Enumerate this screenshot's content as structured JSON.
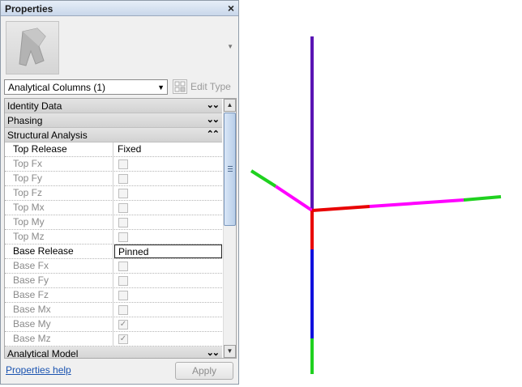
{
  "panel": {
    "title": "Properties",
    "close_glyph": "×"
  },
  "type_selector": {
    "value": "Analytical Columns (1)",
    "edit_type_label": "Edit Type"
  },
  "groups": {
    "identity": {
      "label": "Identity Data",
      "state": "collapsed"
    },
    "phasing": {
      "label": "Phasing",
      "state": "collapsed"
    },
    "structural": {
      "label": "Structural Analysis",
      "state": "expanded"
    },
    "analytical_model": {
      "label": "Analytical Model",
      "state": "collapsed"
    }
  },
  "params": {
    "top_release": {
      "name": "Top Release",
      "value": "Fixed"
    },
    "top_fx": {
      "name": "Top Fx",
      "checked": false
    },
    "top_fy": {
      "name": "Top Fy",
      "checked": false
    },
    "top_fz": {
      "name": "Top Fz",
      "checked": false
    },
    "top_mx": {
      "name": "Top Mx",
      "checked": false
    },
    "top_my": {
      "name": "Top My",
      "checked": false
    },
    "top_mz": {
      "name": "Top Mz",
      "checked": false
    },
    "base_release": {
      "name": "Base Release",
      "value": "Pinned"
    },
    "base_fx": {
      "name": "Base Fx",
      "checked": false
    },
    "base_fy": {
      "name": "Base Fy",
      "checked": false
    },
    "base_fz": {
      "name": "Base Fz",
      "checked": false
    },
    "base_mx": {
      "name": "Base Mx",
      "checked": false
    },
    "base_my": {
      "name": "Base My",
      "checked": true
    },
    "base_mz": {
      "name": "Base Mz",
      "checked": true
    }
  },
  "footer": {
    "help_link": "Properties help",
    "apply_label": "Apply"
  },
  "colors": {
    "axis_x": "#ff00ff",
    "axis_y": "#2f2fd2",
    "axis_z": "#5a14b4",
    "local_red": "#e80000",
    "local_green": "#1fd11f",
    "local_blue": "#1010dd"
  },
  "icons": {
    "close": "close-icon",
    "chevron_down": "double-chevron-down-icon",
    "chevron_up": "double-chevron-up-icon",
    "edit_type": "edit-type-icon",
    "preview": "family-preview-icon"
  }
}
